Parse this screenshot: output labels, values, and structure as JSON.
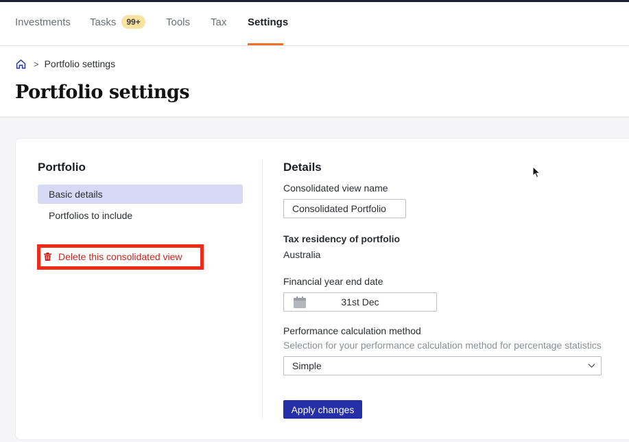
{
  "nav": {
    "items": [
      {
        "label": "Investments"
      },
      {
        "label": "Tasks",
        "badge": "99+"
      },
      {
        "label": "Tools"
      },
      {
        "label": "Tax"
      },
      {
        "label": "Settings",
        "active": true
      }
    ]
  },
  "breadcrumb": {
    "home_icon": "home-icon",
    "separator": ">",
    "current": "Portfolio settings"
  },
  "page": {
    "title": "Portfolio settings"
  },
  "sidebar": {
    "title": "Portfolio",
    "items": [
      {
        "label": "Basic details",
        "selected": true
      },
      {
        "label": "Portfolios to include"
      }
    ],
    "delete_label": "Delete this consolidated view",
    "delete_icon": "trash-icon"
  },
  "details": {
    "title": "Details",
    "view_name_label": "Consolidated view name",
    "view_name_value": "Consolidated Portfolio",
    "tax_residency_label": "Tax residency of portfolio",
    "tax_residency_value": "Australia",
    "fy_end_label": "Financial year end date",
    "fy_end_value": "31st Dec",
    "perf_label": "Performance calculation method",
    "perf_help": "Selection for your performance calculation method for percentage statistics",
    "perf_value": "Simple",
    "apply_label": "Apply changes"
  },
  "colors": {
    "accent": "#f36f29",
    "primary": "#2530a8",
    "selected_bg": "#d6d8f4",
    "delete_red": "#c8231a",
    "highlight_box": "#ee2b1b",
    "badge_bg": "#f8e3a0"
  }
}
